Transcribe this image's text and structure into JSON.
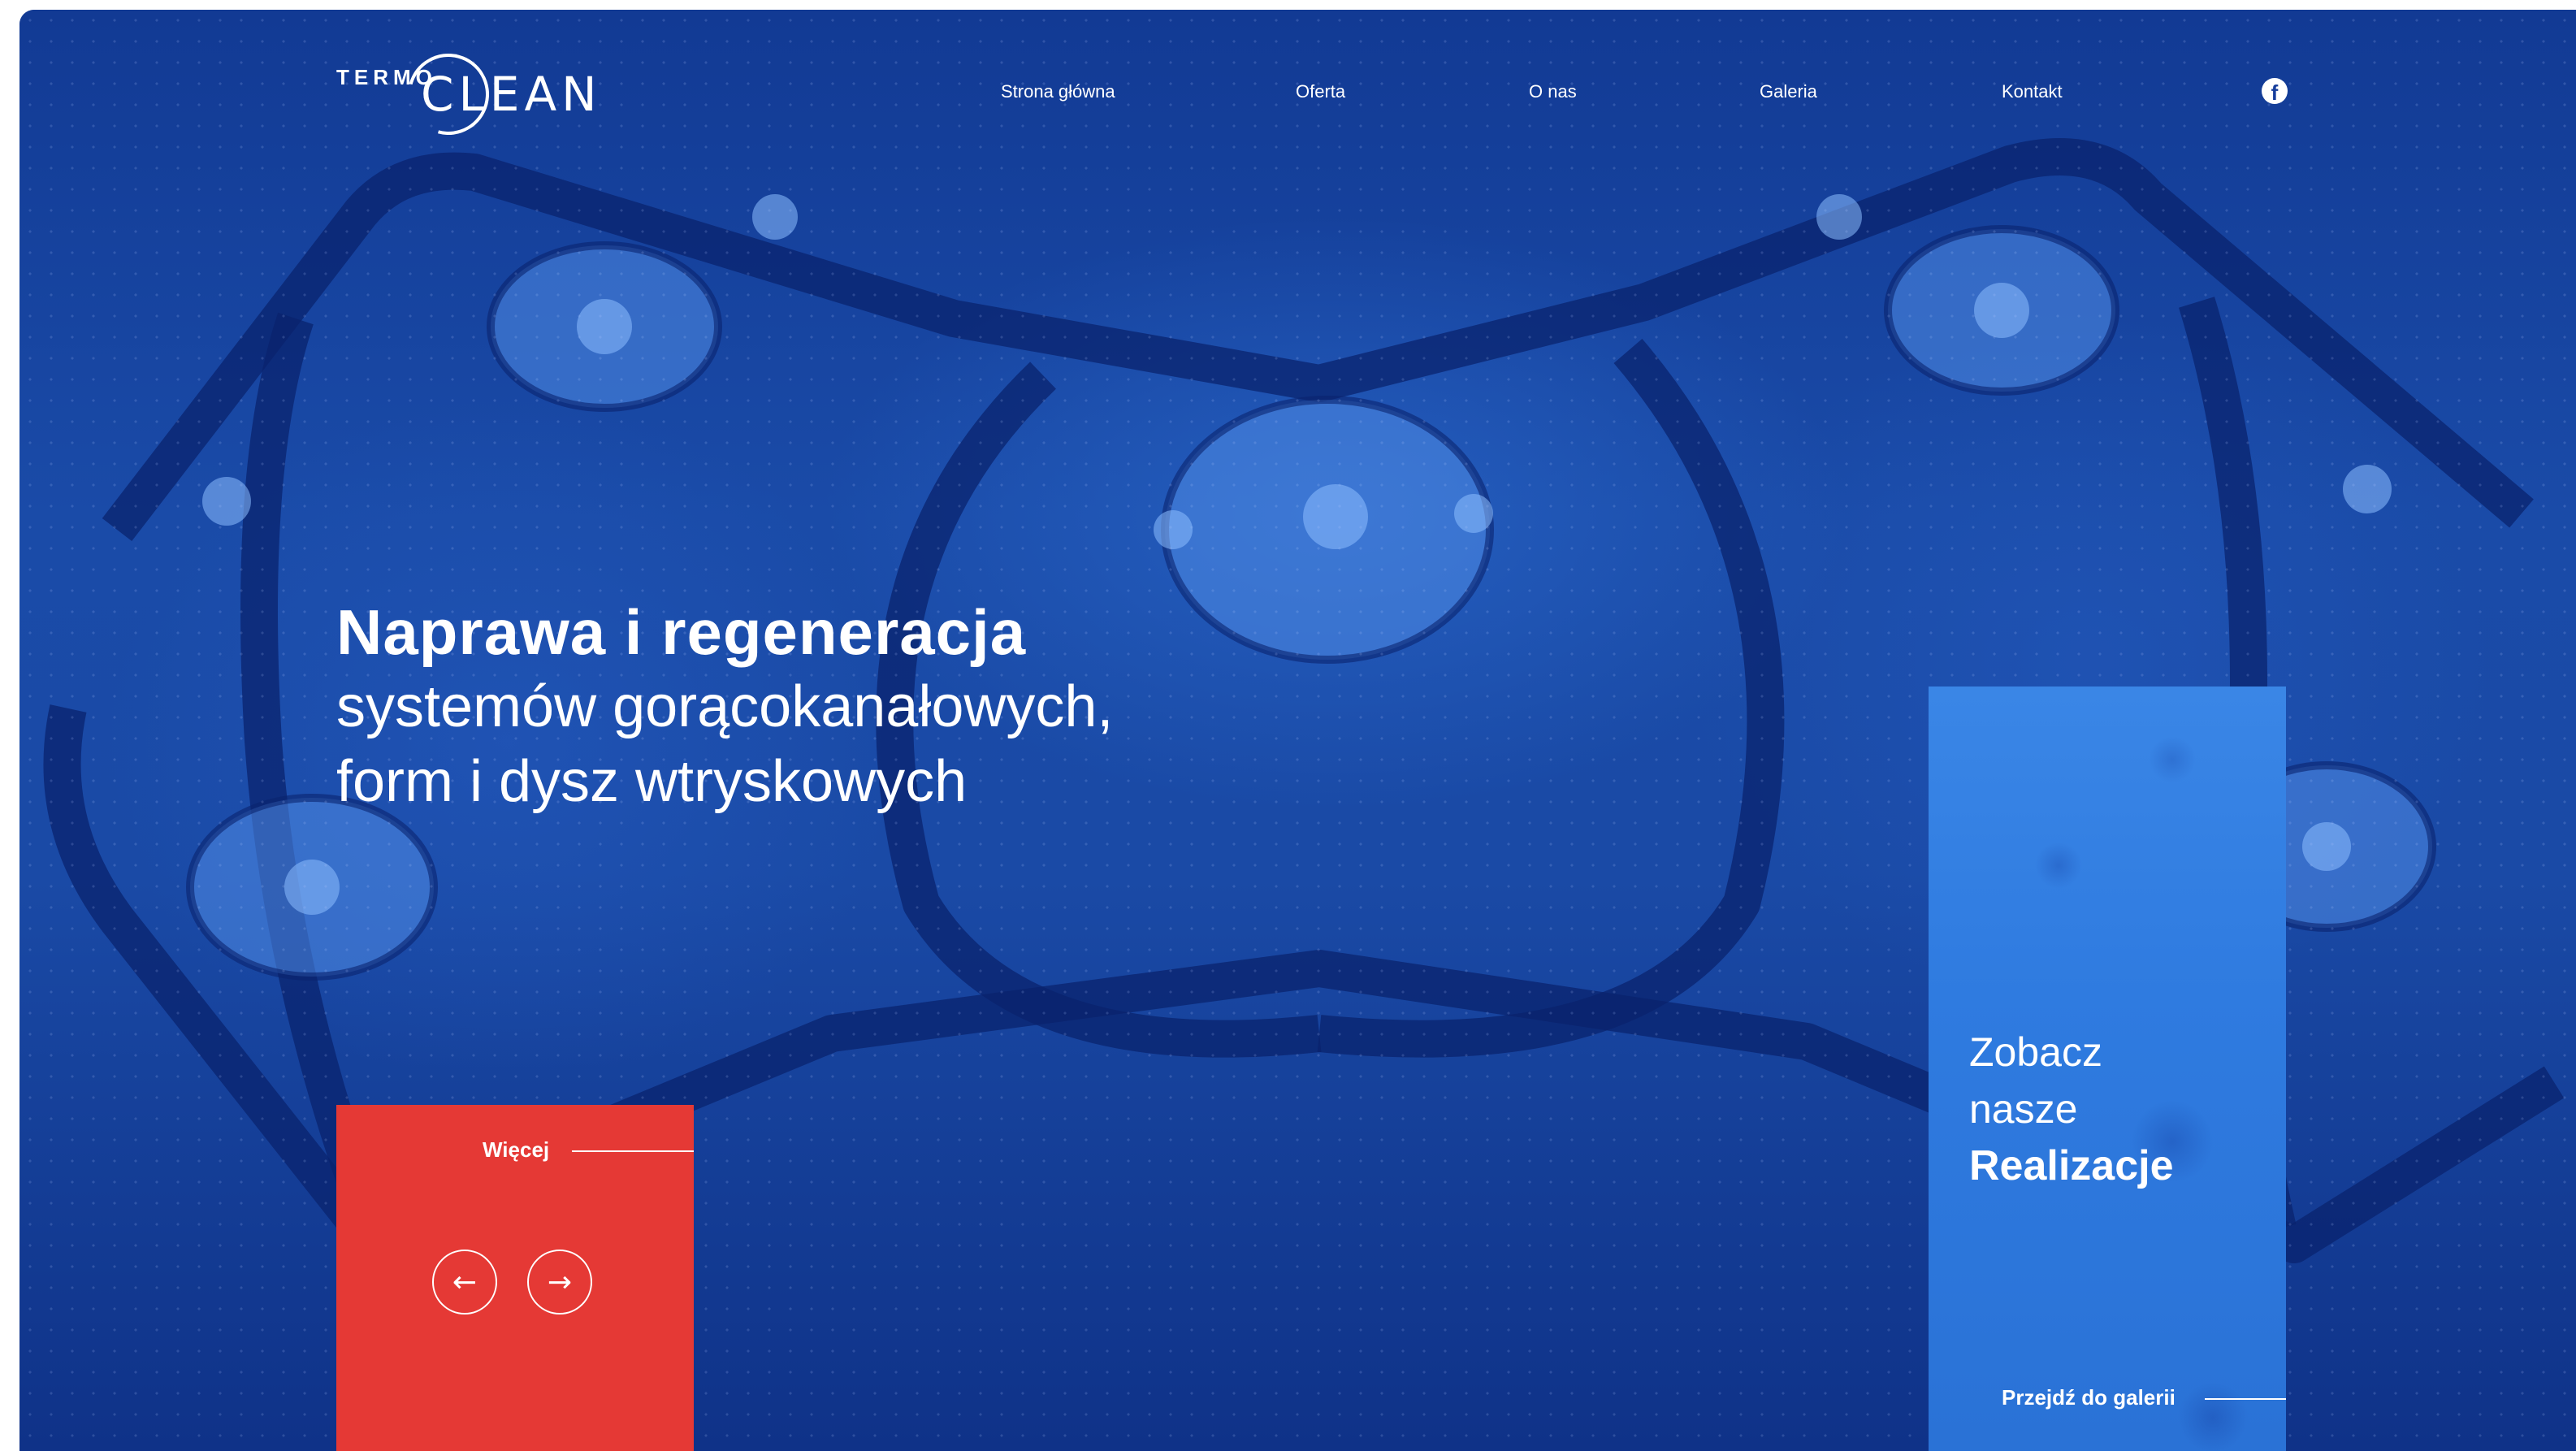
{
  "brand": {
    "logo_word_top": "TERMO",
    "logo_word_main": "CLEAN"
  },
  "nav": {
    "items": [
      {
        "label": "Strona główna"
      },
      {
        "label": "Oferta"
      },
      {
        "label": "O nas"
      },
      {
        "label": "Galeria"
      },
      {
        "label": "Kontakt"
      }
    ],
    "facebook_icon": "facebook-icon",
    "facebook_glyph": "f"
  },
  "hero": {
    "title_bold": "Naprawa i regeneracja",
    "title_line2": "systemów gorącokanałowych,",
    "title_line3": "form i dysz wtryskowych"
  },
  "cta": {
    "more_label": "Więcej",
    "prev_icon": "arrow-left-icon",
    "prev_glyph": "←",
    "next_icon": "arrow-right-icon",
    "next_glyph": "→"
  },
  "gallery": {
    "line1": "Zobacz",
    "line2": "nasze",
    "line3": "Realizacje",
    "link_label": "Przejdź do galerii"
  },
  "colors": {
    "hero_blue": "#1a4ba8",
    "accent_red": "#e53935",
    "card_blue": "#2f7be0",
    "text": "#ffffff"
  }
}
